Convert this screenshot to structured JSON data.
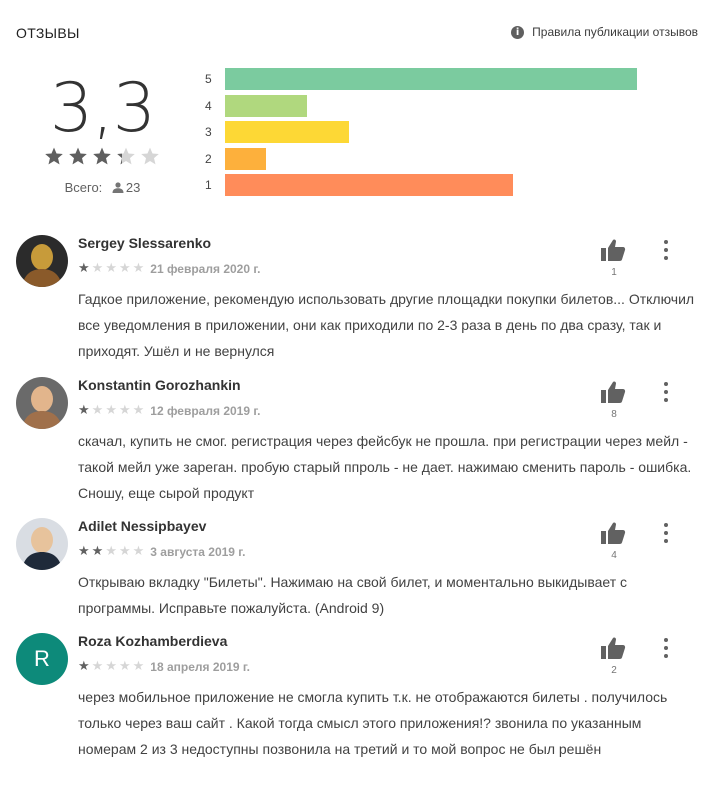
{
  "header": {
    "title": "ОТЗЫВЫ",
    "policy_link": "Правила публикации отзывов"
  },
  "summary": {
    "score": "3,3",
    "stars": 3.3,
    "total_label": "Всего:",
    "total_count": "23"
  },
  "histogram": {
    "rows": [
      {
        "label": "5",
        "fraction": 1.0,
        "color": "#7bcb9f"
      },
      {
        "label": "4",
        "fraction": 0.2,
        "color": "#b0d87e"
      },
      {
        "label": "3",
        "fraction": 0.3,
        "color": "#fdd835"
      },
      {
        "label": "2",
        "fraction": 0.1,
        "color": "#fdb03c"
      },
      {
        "label": "1",
        "fraction": 0.7,
        "color": "#ff8c5a"
      }
    ]
  },
  "reviews": [
    {
      "name": "Sergey Slessarenko",
      "rating": 1,
      "date": "21 февраля 2020 г.",
      "likes": "1",
      "avatar": "photo",
      "text": "Гадкое приложение, рекомендую использовать другие площадки покупки билетов... Отключил все уведомления в приложении, они как приходили по 2-3 раза в день по два сразу, так и приходят. Ушёл и не вернулся"
    },
    {
      "name": "Konstantin Gorozhankin",
      "rating": 1,
      "date": "12 февраля 2019 г.",
      "likes": "8",
      "avatar": "photo",
      "text": "скачал, купить не смог. регистрация через фейсбук не прошла. при регистрации через мейл - такой мейл уже зареган. пробую старый ппроль - не дает. нажимаю сменить пароль - ошибка. Сношу, еще сырой продукт"
    },
    {
      "name": "Adilet Nessipbayev",
      "rating": 2,
      "date": "3 августа 2019 г.",
      "likes": "4",
      "avatar": "photo",
      "text": "Открываю вкладку \"Билеты\". Нажимаю на свой билет, и моментально выкидывает с программы. Исправьте пожалуйста. (Android 9)"
    },
    {
      "name": "Roza Kozhamberdieva",
      "rating": 1,
      "date": "18 апреля 2019 г.",
      "likes": "2",
      "avatar_letter": "R",
      "text": "через мобильное приложение не смогла купить т.к. не отображаются билеты . получилось только через ваш сайт . Какой тогда смысл этого приложения!? звонила по указанным номерам 2 из 3 недоступны позвонила на третий и то мой вопрос не был решён"
    }
  ]
}
